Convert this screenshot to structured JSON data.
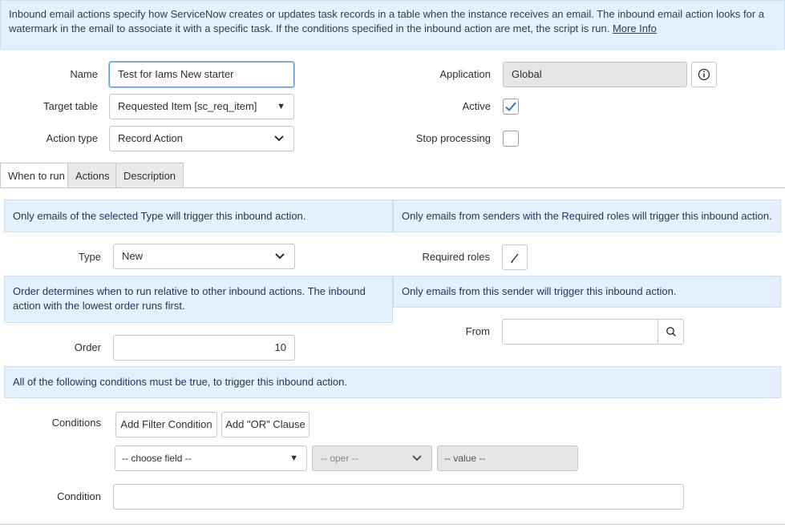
{
  "intro": {
    "text": "Inbound email actions specify how ServiceNow creates or updates task records in a table when the instance receives an email. The inbound email action looks for a watermark in the email to associate it with a specific task. If the conditions specified in the inbound action are met, the script is run.",
    "more_info": "More Info"
  },
  "form": {
    "name_label": "Name",
    "name_value": "Test for Iams New starter",
    "target_table_label": "Target table",
    "target_table_value": "Requested Item [sc_req_item]",
    "action_type_label": "Action type",
    "action_type_value": "Record Action",
    "application_label": "Application",
    "application_value": "Global",
    "active_label": "Active",
    "active_checked": true,
    "stop_processing_label": "Stop processing",
    "stop_processing_checked": false
  },
  "tabs": [
    {
      "label": "When to run",
      "active": true
    },
    {
      "label": "Actions",
      "active": false
    },
    {
      "label": "Description",
      "active": false
    }
  ],
  "when_to_run": {
    "type_info": "Only emails of the selected Type will trigger this inbound action.",
    "roles_info": "Only emails from senders with the Required roles will trigger this inbound action.",
    "type_label": "Type",
    "type_value": "New",
    "required_roles_label": "Required roles",
    "order_info": "Order determines when to run relative to other inbound actions. The inbound action with the lowest order runs first.",
    "sender_info": "Only emails from this sender will trigger this inbound action.",
    "order_label": "Order",
    "order_value": "10",
    "from_label": "From",
    "from_value": "",
    "conditions_info": "All of the following conditions must be true, to trigger this inbound action.",
    "conditions_label": "Conditions",
    "add_filter_label": "Add Filter Condition",
    "add_or_label": "Add \"OR\" Clause",
    "choose_field": "-- choose field --",
    "oper": "-- oper --",
    "value": "-- value --",
    "condition_label": "Condition",
    "condition_value": ""
  }
}
